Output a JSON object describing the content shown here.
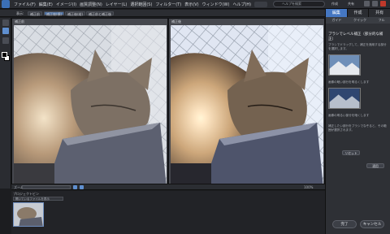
{
  "menubar": {
    "items": [
      "ファイル(F)",
      "編集(E)",
      "イメージ(I)",
      "画質調整(N)",
      "レイヤー(L)",
      "選択範囲(S)",
      "フィルター(T)",
      "表示(V)",
      "ウィンドウ(W)",
      "ヘルプ(H)"
    ],
    "search_placeholder": "ヘルプを検索",
    "share_label": "作成",
    "order_label": "共有"
  },
  "toolbar2": {
    "items": [
      "表示:",
      "補正前",
      "補正後(横)",
      "補正後(縦)",
      "補正前と補正後"
    ]
  },
  "panes": {
    "before_label": "補正前",
    "after_label": "補正後"
  },
  "zoom": {
    "label": "ズーム:",
    "value": "100%"
  },
  "bin": {
    "title": "プロジェクトビン",
    "select_value": "開いているファイルを表示"
  },
  "right_panel": {
    "tabs": [
      "編集",
      "作成",
      "共有"
    ],
    "subtabs": [
      "ガイド",
      "クイック",
      "フル"
    ],
    "heading": "ブラシでレベル補正（部分的な補正）",
    "text1": "ブラシでドラッグして、補正を適用する部分を選択します。",
    "caption1": "画像の暗い部分を明るくします",
    "caption2": "画像の明るい部分を暗くします",
    "text2": "補正したい部分をブラシでなぞると、その範囲が選択されます。",
    "button_reset": "リセット",
    "button_apply": "適用",
    "ok": "完了",
    "cancel": "キャンセル"
  },
  "colors": {
    "accent": "#4577c2",
    "background": "#1c1d20",
    "panel": "#2e3035"
  }
}
